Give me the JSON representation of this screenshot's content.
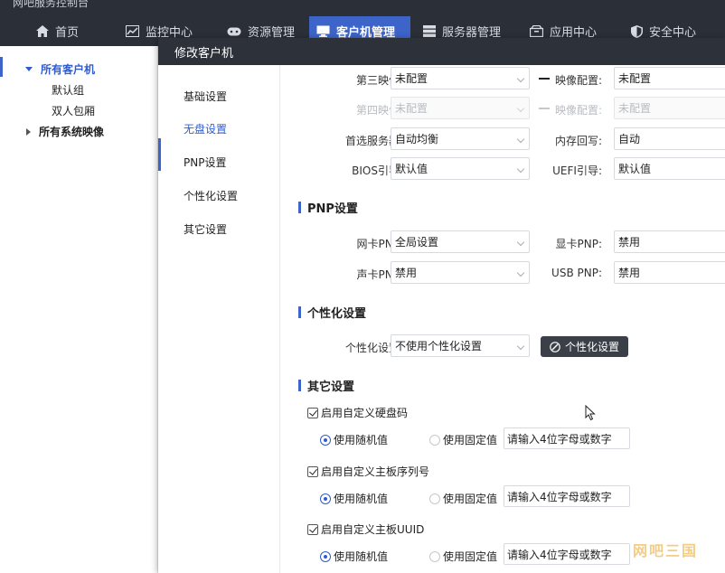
{
  "app": {
    "title_partial": "网吧服务控制台"
  },
  "nav": {
    "items": [
      {
        "label": "首页",
        "icon": "home-icon"
      },
      {
        "label": "监控中心",
        "icon": "monitor-chart-icon"
      },
      {
        "label": "资源管理",
        "icon": "gamepad-icon"
      },
      {
        "label": "客户机管理",
        "icon": "desktop-icon",
        "active": true
      },
      {
        "label": "服务器管理",
        "icon": "server-icon"
      },
      {
        "label": "应用中心",
        "icon": "box-icon"
      },
      {
        "label": "安全中心",
        "icon": "shield-icon"
      }
    ]
  },
  "tree": {
    "root": "所有客户机",
    "children": [
      "默认组",
      "双人包厢"
    ],
    "images": "所有系统映像"
  },
  "dialog": {
    "title": "修改客户机",
    "side_items": [
      "基础设置",
      "无盘设置",
      "PNP设置",
      "个性化设置",
      "其它设置"
    ],
    "active_side": "无盘设置",
    "disk": {
      "third_image_label": "第三映像:",
      "third_image_value": "未配置",
      "image_config_label": "映像配置:",
      "image_config_value": "未配置",
      "fourth_image_label": "第四映像:",
      "fourth_image_value": "未配置",
      "image_config2_label": "映像配置:",
      "image_config2_value": "未配置",
      "pref_server_label": "首选服务器:",
      "pref_server_value": "自动均衡",
      "mem_writeback_label": "内存回写:",
      "mem_writeback_value": "自动",
      "bios_label": "BIOS引导:",
      "bios_value": "默认值",
      "uefi_label": "UEFI引导:",
      "uefi_value": "默认值"
    },
    "pnp": {
      "title": "PNP设置",
      "nic_label": "网卡PNP:",
      "nic_value": "全局设置",
      "gpu_label": "显卡PNP:",
      "gpu_value": "禁用",
      "sound_label": "声卡PNP:",
      "sound_value": "禁用",
      "usb_label": "USB PNP:",
      "usb_value": "禁用"
    },
    "personal": {
      "title": "个性化设置",
      "label": "个性化设置:",
      "value": "不使用个性化设置",
      "button": "个性化设置"
    },
    "other": {
      "title": "其它设置",
      "groups": [
        {
          "check": "启用自定义硬盘码",
          "random": "使用随机值",
          "fixed": "使用固定值",
          "placeholder": "请输入4位字母或数字"
        },
        {
          "check": "启用自定义主板序列号",
          "random": "使用随机值",
          "fixed": "使用固定值",
          "placeholder": "请输入4位字母或数字"
        },
        {
          "check": "启用自定义主板UUID",
          "random": "使用随机值",
          "fixed": "使用固定值",
          "placeholder": "请输入4位字母或数字"
        }
      ]
    }
  },
  "watermark": "网吧三国",
  "colors": {
    "accent": "#3d64c9",
    "topbar": "#2a2f38",
    "dialog_header": "#2c313a"
  }
}
